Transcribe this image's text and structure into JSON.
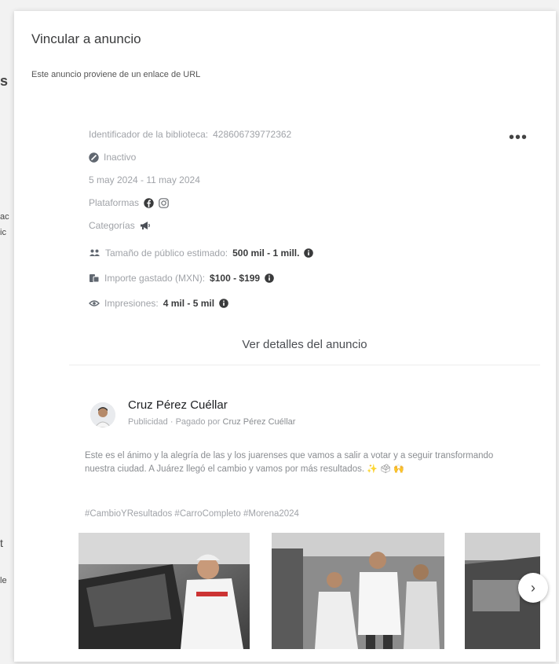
{
  "modal": {
    "title": "Vincular a anuncio",
    "subtitle": "Este anuncio proviene de un enlace de URL"
  },
  "ad": {
    "library_id_label": "Identificador de la biblioteca:",
    "library_id_value": "428606739772362",
    "status": "Inactivo",
    "date_range": "5 may 2024 - 11 may 2024",
    "platforms_label": "Plataformas",
    "platforms": [
      "facebook-icon",
      "instagram-icon"
    ],
    "categories_label": "Categorías",
    "categories": [
      "megaphone-icon"
    ],
    "audience_label": "Tamaño de público estimado:",
    "audience_value": "500 mil - 1 mill.",
    "spend_label": "Importe gastado (MXN):",
    "spend_value": "$100 - $199",
    "impressions_label": "Impresiones:",
    "impressions_value": "4 mil - 5 mil",
    "details_button": "Ver detalles del anuncio"
  },
  "post": {
    "page_name": "Cruz Pérez Cuéllar",
    "sponsored_label": "Publicidad",
    "paid_by_label": "Pagado por",
    "paid_by_name": "Cruz Pérez Cuéllar",
    "body": "Este es el ánimo y la alegría de las y los juarenses que vamos a salir a votar y a seguir transformando nuestra ciudad. A Juárez llegó el cambio y vamos por más resultados.",
    "hashtags": "#CambioYResultados #CarroCompleto #Morena2024"
  },
  "background": {
    "left_fragments": [
      "s",
      "ac",
      "ic",
      "t",
      "le"
    ]
  },
  "colors": {
    "modal_bg": "#ffffff",
    "muted_text": "#a0a3a8",
    "strong_text": "#3a3b3c"
  }
}
